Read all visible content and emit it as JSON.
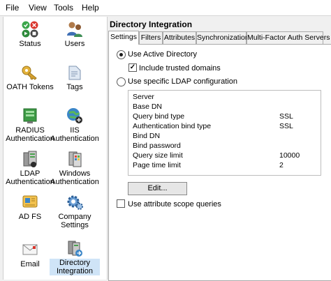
{
  "menu": [
    "File",
    "View",
    "Tools",
    "Help"
  ],
  "sidebar": {
    "items": [
      {
        "label": "Status",
        "icon": "status-icon"
      },
      {
        "label": "Users",
        "icon": "users-icon"
      },
      {
        "label": "OATH Tokens",
        "icon": "oath-tokens-icon"
      },
      {
        "label": "Tags",
        "icon": "tags-icon"
      },
      {
        "label": "RADIUS Authentication",
        "line1": "RADIUS",
        "line2": "Authentication",
        "icon": "radius-icon"
      },
      {
        "label": "IIS Authentication",
        "line1": "IIS",
        "line2": "Authentication",
        "icon": "iis-icon"
      },
      {
        "label": "LDAP Authentication",
        "line1": "LDAP",
        "line2": "Authentication",
        "icon": "ldap-icon"
      },
      {
        "label": "Windows Authentication",
        "line1": "Windows",
        "line2": "Authentication",
        "icon": "windows-icon"
      },
      {
        "label": "AD FS",
        "icon": "adfs-icon"
      },
      {
        "label": "Company Settings",
        "line1": "Company",
        "line2": "Settings",
        "icon": "company-settings-icon"
      },
      {
        "label": "Email",
        "icon": "email-icon"
      },
      {
        "label": "Directory Integration",
        "line1": "Directory",
        "line2": "Integration",
        "icon": "directory-integration-icon",
        "selected": true
      }
    ]
  },
  "main": {
    "title": "Directory Integration",
    "tabs": [
      "Settings",
      "Filters",
      "Attributes",
      "Synchronization",
      "Multi-Factor Auth Servers"
    ],
    "active_tab": "Settings",
    "use_ad_label": "Use Active Directory",
    "include_trusted_label": "Include trusted domains",
    "include_trusted_checked": true,
    "use_ldap_label": "Use specific LDAP configuration",
    "ldap_rows": [
      {
        "key": "Server",
        "value": ""
      },
      {
        "key": "Base DN",
        "value": ""
      },
      {
        "key": "Query bind type",
        "value": "SSL"
      },
      {
        "key": "Authentication bind type",
        "value": "SSL"
      },
      {
        "key": "Bind DN",
        "value": ""
      },
      {
        "key": "Bind password",
        "value": ""
      },
      {
        "key": "Query size limit",
        "value": "10000"
      },
      {
        "key": "Page time limit",
        "value": "2"
      }
    ],
    "edit_button": "Edit...",
    "attr_scope_label": "Use attribute scope queries",
    "attr_scope_checked": false
  },
  "colors": {
    "selection": "#cfe4f7",
    "panel": "#ffffff",
    "window": "#f0f0f0"
  }
}
